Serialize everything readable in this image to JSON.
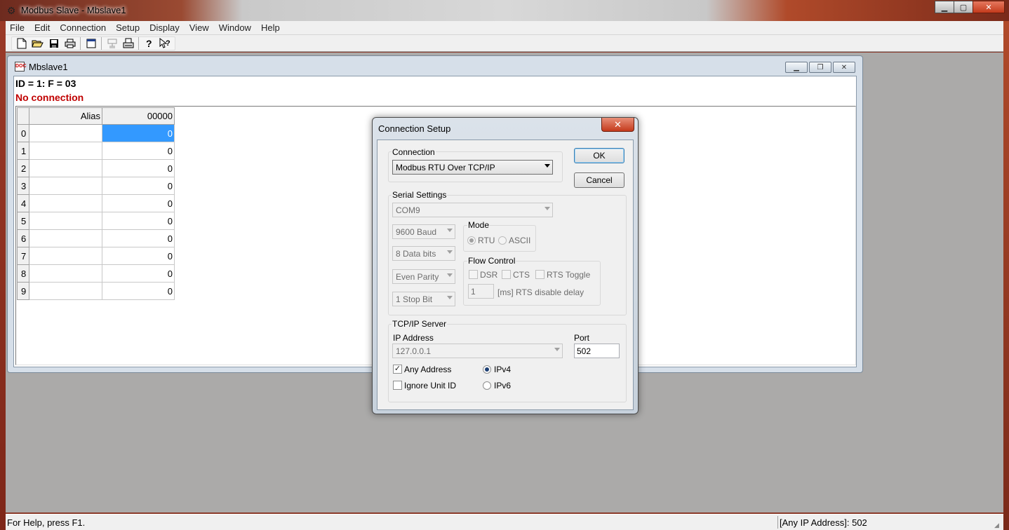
{
  "window": {
    "title": "Modbus Slave - Mbslave1",
    "minimize_glyph": "▁",
    "maximize_glyph": "▢",
    "close_glyph": "✕"
  },
  "menu": [
    "File",
    "Edit",
    "Connection",
    "Setup",
    "Display",
    "View",
    "Window",
    "Help"
  ],
  "toolbar": {
    "icons": [
      "new-icon",
      "open-icon",
      "save-icon",
      "print-icon",
      "window-icon",
      "connect-icon",
      "printer-setup-icon",
      "help-icon",
      "context-help-icon"
    ]
  },
  "child": {
    "title": "Mbslave1",
    "id_line": "ID = 1: F = 03",
    "connection_status": "No connection",
    "grid": {
      "headers": [
        "Alias",
        "00000"
      ],
      "rows": [
        {
          "index": "0",
          "alias": "",
          "value": "0"
        },
        {
          "index": "1",
          "alias": "",
          "value": "0"
        },
        {
          "index": "2",
          "alias": "",
          "value": "0"
        },
        {
          "index": "3",
          "alias": "",
          "value": "0"
        },
        {
          "index": "4",
          "alias": "",
          "value": "0"
        },
        {
          "index": "5",
          "alias": "",
          "value": "0"
        },
        {
          "index": "6",
          "alias": "",
          "value": "0"
        },
        {
          "index": "7",
          "alias": "",
          "value": "0"
        },
        {
          "index": "8",
          "alias": "",
          "value": "0"
        },
        {
          "index": "9",
          "alias": "",
          "value": "0"
        }
      ]
    }
  },
  "dialog": {
    "title": "Connection Setup",
    "close_glyph": "✕",
    "connection_label": "Connection",
    "connection_value": "Modbus RTU Over TCP/IP",
    "ok_label": "OK",
    "cancel_label": "Cancel",
    "serial_label": "Serial Settings",
    "port_value": "COM9",
    "baud_value": "9600 Baud",
    "databits_value": "8 Data bits",
    "parity_value": "Even Parity",
    "stopbits_value": "1 Stop Bit",
    "mode_label": "Mode",
    "mode_rtu": "RTU",
    "mode_ascii": "ASCII",
    "flow_label": "Flow Control",
    "flow_dsr": "DSR",
    "flow_cts": "CTS",
    "flow_rts_toggle": "RTS Toggle",
    "rts_delay_value": "1",
    "rts_delay_label": "[ms] RTS disable delay",
    "tcp_label": "TCP/IP Server",
    "ip_label": "IP Address",
    "ip_value": "127.0.0.1",
    "port_label": "Port",
    "port_number": "502",
    "any_address_label": "Any Address",
    "ignore_unit_label": "Ignore Unit ID",
    "ipv4_label": "IPv4",
    "ipv6_label": "IPv6",
    "check_glyph": "✓"
  },
  "status": {
    "help_text": "For Help, press F1.",
    "connection_text": "[Any IP Address]: 502"
  }
}
